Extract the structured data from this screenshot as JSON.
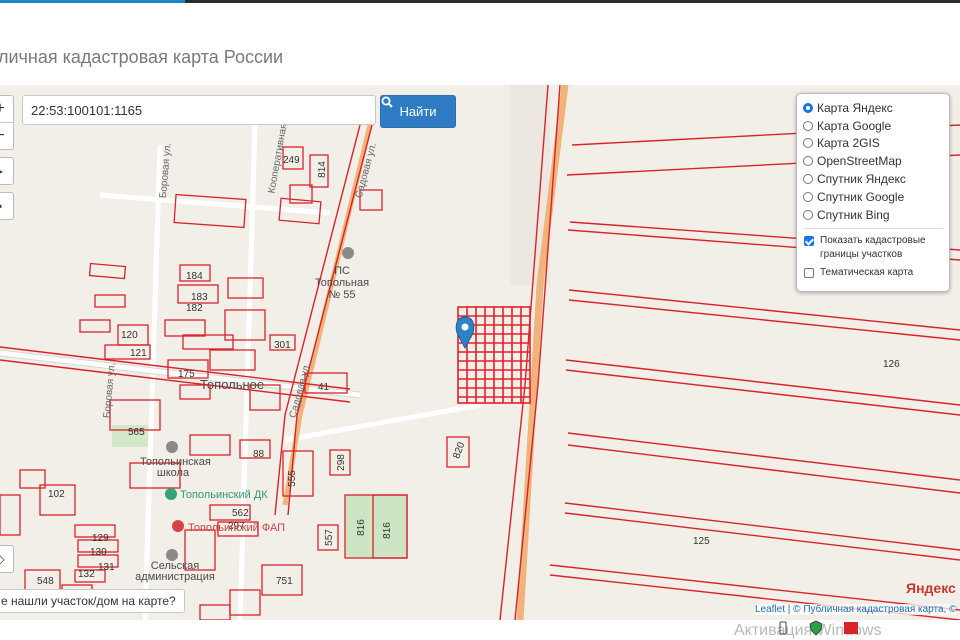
{
  "page": {
    "title": "личная кадастровая карта России"
  },
  "search": {
    "value": "22:53:100101:1165",
    "button_label": "Найти"
  },
  "zoom": {
    "in_label": "+",
    "out_label": "−"
  },
  "layers": {
    "base": [
      {
        "label": "Карта Яндекс",
        "selected": true
      },
      {
        "label": "Карта Google",
        "selected": false
      },
      {
        "label": "Карта 2GIS",
        "selected": false
      },
      {
        "label": "OpenStreetMap",
        "selected": false
      },
      {
        "label": "Спутник Яндекс",
        "selected": false
      },
      {
        "label": "Спутник Google",
        "selected": false
      },
      {
        "label": "Спутник Bing",
        "selected": false
      }
    ],
    "overlays": [
      {
        "label": "Показать кадастровые границы участков",
        "checked": true
      },
      {
        "label": "Тематическая карта",
        "checked": false
      }
    ]
  },
  "map": {
    "streets": [
      "Боровая ул.",
      "Кооперативная ул.",
      "Садовая ул.",
      "Боровая ул.",
      "Садовая ул."
    ],
    "places": [
      "ПС Топольная № 55",
      "Топольное",
      "Топольинская школа",
      "Топольинский ДК",
      "Топольинский ФАП",
      "Сельская администрация"
    ],
    "parcel_numbers": [
      "249",
      "814",
      "184",
      "183",
      "182",
      "120",
      "121",
      "175",
      "301",
      "41",
      "565",
      "88",
      "555",
      "298",
      "820",
      "102",
      "562",
      "297",
      "816",
      "816",
      "557",
      "129",
      "130",
      "131",
      "132",
      "548",
      "751",
      "126",
      "125"
    ]
  },
  "footer": {
    "not_found_label": "е нашли участок/дом на карте?",
    "yandex_logo": "Яндекс",
    "attribution": "Leaflet | © Публичная кадастровая карта, ©",
    "watermark": "Активация Windows"
  },
  "colors": {
    "accent": "#2f7cc4",
    "parcel": "#d9232a",
    "road_orange": "#f0b37a",
    "map_bg": "#f2efe9",
    "selected_parcel": "#e3202b"
  }
}
